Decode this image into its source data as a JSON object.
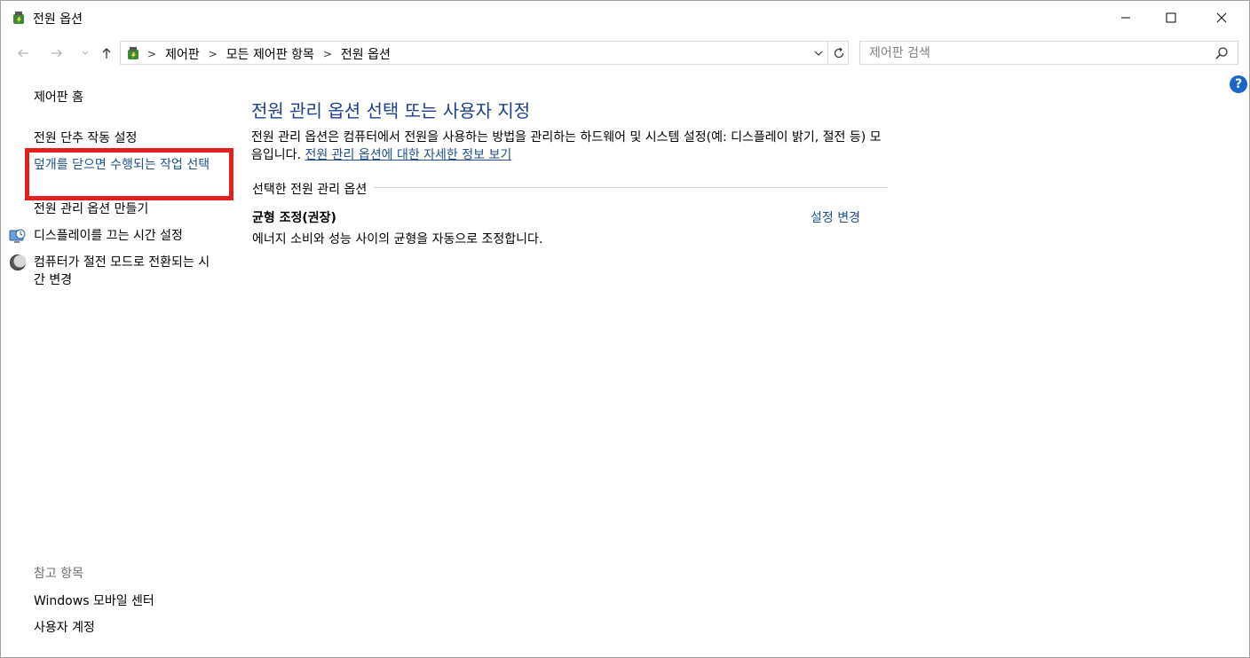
{
  "window": {
    "title": "전원 옵션"
  },
  "address": {
    "crumbs": [
      "제어판",
      "모든 제어판 항목",
      "전원 옵션"
    ]
  },
  "search": {
    "placeholder": "제어판 검색"
  },
  "help": {
    "label": "?"
  },
  "sidebar": {
    "items": [
      {
        "label": "제어판 홈"
      },
      {
        "label": "전원 단추 작동 설정"
      },
      {
        "label": "덮개를 닫으면 수행되는 작업 선택"
      },
      {
        "label": "전원 관리 옵션 만들기"
      },
      {
        "label": "디스플레이를 끄는 시간 설정",
        "icon": "display-clock-icon"
      },
      {
        "label": "컴퓨터가 절전 모드로 전환되는 시간 변경",
        "icon": "moon-icon"
      }
    ],
    "see_also": {
      "title": "참고 항목",
      "items": [
        {
          "label": "Windows 모바일 센터"
        },
        {
          "label": "사용자 계정"
        }
      ]
    }
  },
  "main": {
    "title": "전원 관리 옵션 선택 또는 사용자 지정",
    "description": "전원 관리 옵션은 컴퓨터에서 전원을 사용하는 방법을 관리하는 하드웨어 및 시스템 설정(예: 디스플레이 밝기, 절전 등) 모음입니다.",
    "more_link": "전원 관리 옵션에 대한 자세한 정보 보기",
    "section_title": "선택한 전원 관리 옵션",
    "plan": {
      "name": "균형 조정(권장)",
      "change_link": "설정 변경",
      "description": "에너지 소비와 성능 사이의 균형을 자동으로 조정합니다."
    }
  },
  "colors": {
    "link": "#1e4f8f",
    "title": "#1e3f8c",
    "highlight": "#e0211f"
  }
}
